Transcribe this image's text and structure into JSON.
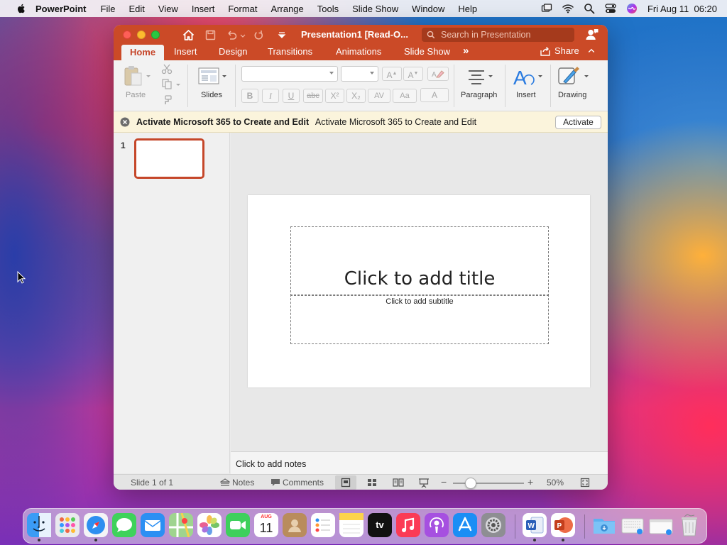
{
  "menubar": {
    "app": "PowerPoint",
    "items": [
      "File",
      "Edit",
      "View",
      "Insert",
      "Format",
      "Arrange",
      "Tools",
      "Slide Show",
      "Window",
      "Help"
    ],
    "datetime": "Fri Aug 11  06:20"
  },
  "window": {
    "title": "Presentation1 [Read-O...",
    "search_placeholder": "Search in Presentation",
    "tabs": [
      "Home",
      "Insert",
      "Design",
      "Transitions",
      "Animations",
      "Slide Show"
    ],
    "more_tabs": "»",
    "share": "Share"
  },
  "ribbon": {
    "paste": "Paste",
    "slides": "Slides",
    "paragraph": "Paragraph",
    "insert": "Insert",
    "drawing": "Drawing",
    "font_buttons": [
      "B",
      "I",
      "U",
      "abc",
      "X²",
      "X₂",
      "AV",
      "Aa",
      "A"
    ]
  },
  "notice": {
    "bold": "Activate Microsoft 365 to Create and Edit",
    "text": "Activate Microsoft 365 to Create and Edit",
    "button": "Activate"
  },
  "thumbnails": {
    "number": "1"
  },
  "slide": {
    "title_placeholder": "Click to add title",
    "subtitle_placeholder": "Click to add subtitle"
  },
  "notes": {
    "placeholder": "Click to add notes"
  },
  "statusbar": {
    "slide_info": "Slide 1 of 1",
    "notes": "Notes",
    "comments": "Comments",
    "zoom": "50%",
    "zoom_percent": 50
  },
  "dock": {
    "calendar_month": "AUG",
    "calendar_day": "11",
    "tv_label": "tv"
  },
  "colors": {
    "accent": "#cb4a27",
    "ribbon_bg": "#f2f2f2",
    "notice_bg": "#fbf4dc"
  }
}
